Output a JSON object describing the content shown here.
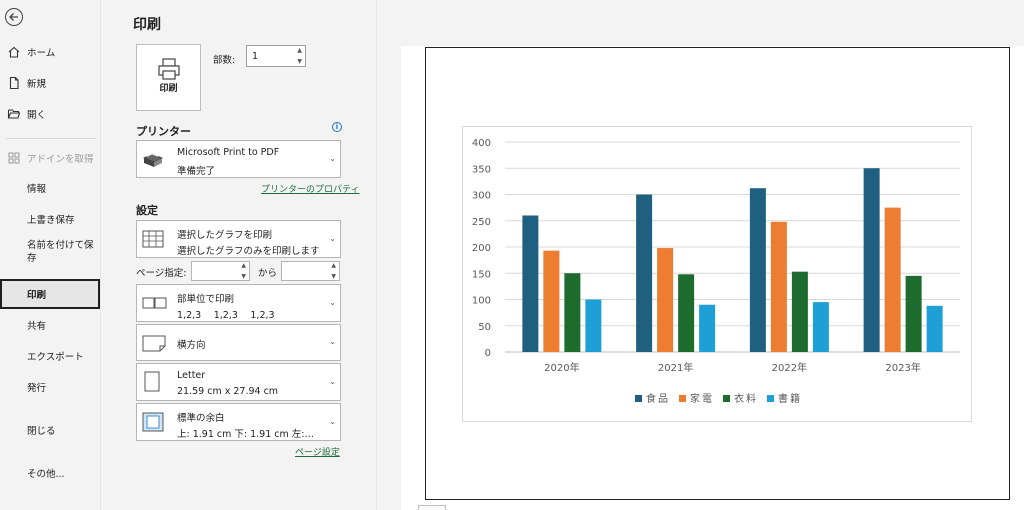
{
  "nav": {
    "items": [
      {
        "label": "ホーム"
      },
      {
        "label": "新規"
      },
      {
        "label": "開く"
      },
      {
        "label": "アドインを取得"
      },
      {
        "label": "情報"
      },
      {
        "label": "上書き保存"
      },
      {
        "label": "名前を付けて保",
        "label2": "存"
      },
      {
        "label": "印刷"
      },
      {
        "label": "共有"
      },
      {
        "label": "エクスポート"
      },
      {
        "label": "発行"
      },
      {
        "label": "閉じる"
      },
      {
        "label": "その他..."
      }
    ]
  },
  "print": {
    "title": "印刷",
    "print_button": "印刷",
    "copies_label": "部数:",
    "copies_value": "1",
    "printer_section": "プリンター",
    "printer_name": "Microsoft Print to PDF",
    "printer_status": "準備完了",
    "printer_properties": "プリンターのプロパティ",
    "settings_section": "設定",
    "what_title": "選択したグラフを印刷",
    "what_desc": "選択したグラフのみを印刷します",
    "pages_label": "ページ指定:",
    "pages_from": "",
    "pages_to_label": "から",
    "pages_to": "",
    "collate_title": "部単位で印刷",
    "collate_desc": "1,2,3　 1,2,3　 1,2,3",
    "orientation": "横方向",
    "paper_title": "Letter",
    "paper_desc": "21.59 cm x 27.94 cm",
    "margins_title": "標準の余白",
    "margins_desc": "上: 1.91 cm 下: 1.91 cm 左:…",
    "page_setup": "ページ設定"
  },
  "colors": {
    "food": "#1f5f7f",
    "appliance": "#ed7d31",
    "clothing": "#1e6b2e",
    "books": "#1ea0d6"
  },
  "chart_data": {
    "type": "bar",
    "categories": [
      "2020年",
      "2021年",
      "2022年",
      "2023年"
    ],
    "series": [
      {
        "name": "食品",
        "values": [
          260,
          300,
          312,
          350
        ]
      },
      {
        "name": "家電",
        "values": [
          193,
          198,
          248,
          275
        ]
      },
      {
        "name": "衣料",
        "values": [
          150,
          148,
          153,
          145
        ]
      },
      {
        "name": "書籍",
        "values": [
          100,
          90,
          95,
          88
        ]
      }
    ],
    "y_ticks": [
      "400",
      "350",
      "300",
      "250",
      "200",
      "150",
      "100",
      "50",
      "0"
    ],
    "ylim": [
      0,
      400
    ],
    "grid": true,
    "legend_position": "bottom"
  }
}
